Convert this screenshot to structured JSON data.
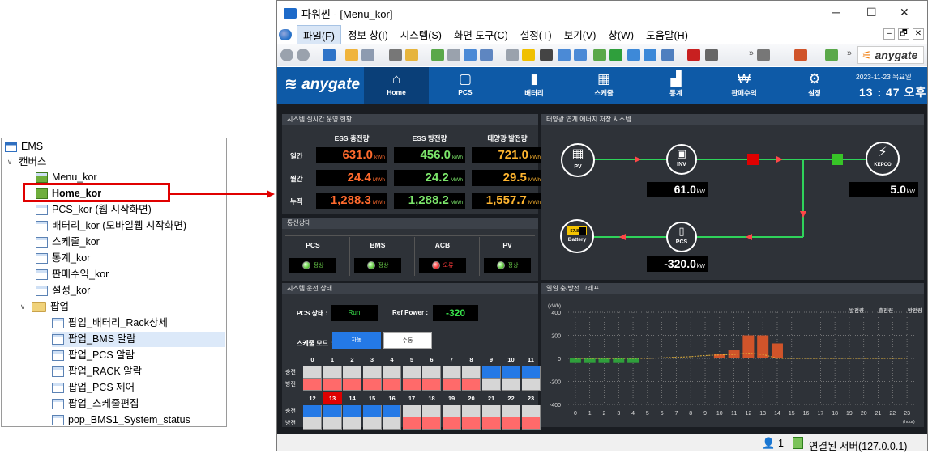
{
  "tree": {
    "root": "EMS",
    "group": "캔버스",
    "items": [
      "Menu_kor",
      "Home_kor",
      "PCS_kor (웹 시작화면)",
      "배터리_kor (모바일웹 시작화면)",
      "스케줄_kor",
      "통계_kor",
      "판매수익_kor",
      "설정_kor"
    ],
    "popup_group": "팝업",
    "popup_items": [
      "팝업_배터리_Rack상세",
      "팝업_BMS 알람",
      "팝업_PCS 알람",
      "팝업_RACK 알람",
      "팝업_PCS 제어",
      "팝업_스케줄편집",
      "pop_BMS1_System_status"
    ]
  },
  "window": {
    "title": "파워씬 - [Menu_kor]",
    "minimize": "─",
    "maximize": "☐",
    "close": "✕",
    "menus": [
      "파일(F)",
      "정보 창(I)",
      "시스템(S)",
      "화면 도구(C)",
      "설정(T)",
      "보기(V)",
      "창(W)",
      "도움말(H)"
    ],
    "mdi": [
      "–",
      "🗗",
      "✕"
    ],
    "brand": "anygate",
    "toolbar_more": "»"
  },
  "nav": {
    "logo": "anygate",
    "items": [
      {
        "label": "Home",
        "icon": "⌂"
      },
      {
        "label": "PCS",
        "icon": "▢"
      },
      {
        "label": "배터리",
        "icon": "▮"
      },
      {
        "label": "스케줄",
        "icon": "▦"
      },
      {
        "label": "통계",
        "icon": "▟"
      },
      {
        "label": "판매수익",
        "icon": "₩"
      },
      {
        "label": "설정",
        "icon": "⚙"
      }
    ],
    "date": "2023-11-23 목요일",
    "time": "13 : 47 오후"
  },
  "realtime": {
    "title": "시스템 실시간 운영 현황",
    "cols": [
      "ESS 충전량",
      "ESS 방전량",
      "태양광 발전량"
    ],
    "rows": [
      {
        "label": "일간",
        "values": [
          "631.0",
          "456.0",
          "721.0"
        ],
        "units": [
          "kWh",
          "kWh",
          "kWh"
        ]
      },
      {
        "label": "월간",
        "values": [
          "24.4",
          "24.2",
          "29.5"
        ],
        "units": [
          "MWh",
          "MWh",
          "MWh"
        ]
      },
      {
        "label": "누적",
        "values": [
          "1,288.3",
          "1,288.2",
          "1,557.7"
        ],
        "units": [
          "MWh",
          "MWh",
          "MWh"
        ]
      }
    ]
  },
  "comm": {
    "title": "통신상태",
    "items": [
      {
        "name": "PCS",
        "status": "정상",
        "color": "#6cd34b"
      },
      {
        "name": "BMS",
        "status": "정상",
        "color": "#6cd34b"
      },
      {
        "name": "ACB",
        "status": "오류",
        "color": "#ff3b3b"
      },
      {
        "name": "PV",
        "status": "정상",
        "color": "#6cd34b"
      }
    ]
  },
  "flow": {
    "title": "태양광 연계 에너지 저장 시스템",
    "pv": "PV",
    "inv": "INV",
    "grid": "KEPCO",
    "battery": "Battery",
    "battery_soc": "57.8 %",
    "pcs": "PCS",
    "inv_value": "61.0",
    "inv_unit": "kW",
    "grid_value": "5.0",
    "grid_unit": "kW",
    "pcs_value": "-320.0",
    "pcs_unit": "kW"
  },
  "opstate": {
    "title": "시스템 운전 상태",
    "pcs_label": "PCS 상태 :",
    "pcs_value": "Run",
    "ref_label": "Ref Power :",
    "ref_value": "-320",
    "mode_label": "스케줄 모드 :",
    "auto": "자동",
    "manual": "수동",
    "charge": "충전",
    "discharge": "방전",
    "hours_am": [
      "0",
      "1",
      "2",
      "3",
      "4",
      "5",
      "6",
      "7",
      "8",
      "9",
      "10",
      "11"
    ],
    "hours_pm": [
      "12",
      "13",
      "14",
      "15",
      "16",
      "17",
      "18",
      "19",
      "20",
      "21",
      "22",
      "23"
    ],
    "current_hour": "13",
    "charge_hours": [
      9,
      10,
      11,
      12,
      13,
      14,
      15,
      16
    ],
    "discharge_hours": [
      0,
      1,
      2,
      3,
      4,
      5,
      6,
      7,
      8,
      17,
      18,
      19,
      20,
      21,
      22,
      23
    ]
  },
  "graph": {
    "title": "일일 충/방전 그래프",
    "legend": [
      "발전량",
      "충전량",
      "방전량"
    ]
  },
  "chart_data": {
    "type": "bar",
    "title": "일일 충/방전 그래프",
    "xlabel": "(hour)",
    "ylabel": "(kWh)",
    "categories": [
      "0",
      "1",
      "2",
      "3",
      "4",
      "5",
      "6",
      "7",
      "8",
      "9",
      "10",
      "11",
      "12",
      "13",
      "14",
      "15",
      "16",
      "17",
      "18",
      "19",
      "20",
      "21",
      "22",
      "23"
    ],
    "ylim": [
      -400,
      400
    ],
    "yticks": [
      400,
      200,
      0,
      -200,
      -400
    ],
    "series": [
      {
        "name": "충전량",
        "color": "#2f9f3c",
        "values": [
          -40,
          -40,
          -40,
          -40,
          -40,
          0,
          0,
          0,
          0,
          0,
          0,
          0,
          0,
          0,
          0,
          0,
          0,
          0,
          0,
          0,
          0,
          0,
          0,
          0
        ]
      },
      {
        "name": "방전량",
        "color": "#d0542a",
        "values": [
          0,
          0,
          0,
          0,
          0,
          0,
          0,
          0,
          0,
          0,
          40,
          70,
          200,
          200,
          130,
          0,
          0,
          0,
          0,
          0,
          0,
          0,
          0,
          0
        ]
      },
      {
        "name": "발전량",
        "color": "#e6b43c",
        "values": [
          0,
          0,
          0,
          0,
          0,
          0,
          5,
          10,
          15,
          25,
          30,
          35,
          45,
          35,
          0,
          0,
          0,
          0,
          0,
          0,
          0,
          0,
          0,
          0
        ]
      }
    ],
    "grid": true,
    "legend": "top-right"
  },
  "statusbar": {
    "users": "1",
    "server": "연결된 서버(127.0.0.1)"
  }
}
